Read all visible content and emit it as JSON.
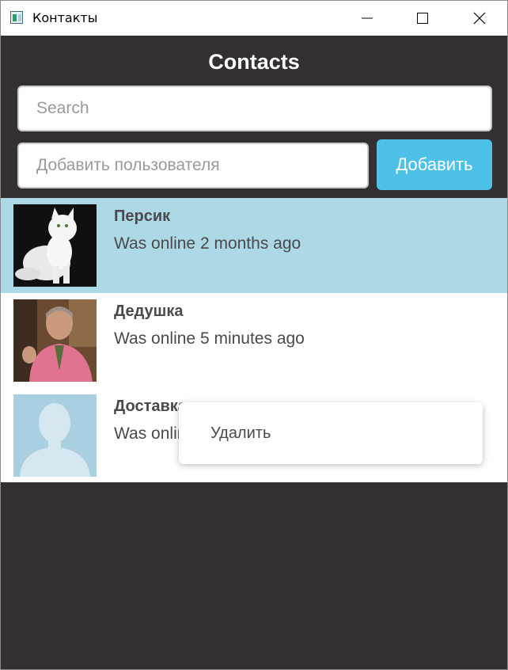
{
  "window": {
    "title": "Контакты",
    "controls": [
      "minimize-icon",
      "maximize-icon",
      "close-icon"
    ]
  },
  "header": {
    "title": "Contacts"
  },
  "search": {
    "placeholder": "Search",
    "value": ""
  },
  "add_user": {
    "placeholder": "Добавить пользователя",
    "value": "",
    "button_label": "Добавить"
  },
  "contacts": [
    {
      "name": "Персик",
      "status": "Was online 2 months ago",
      "selected": true
    },
    {
      "name": "Дедушка",
      "status": "Was online 5 minutes ago",
      "selected": false
    },
    {
      "name": "Доставка",
      "status": "Was online",
      "selected": false
    }
  ],
  "context_menu": {
    "items": [
      {
        "label": "Удалить"
      }
    ]
  },
  "colors": {
    "background": "#342f30",
    "accent": "#4dc1e8",
    "selected_row": "#add8e6",
    "text": "#4a4a4a"
  }
}
